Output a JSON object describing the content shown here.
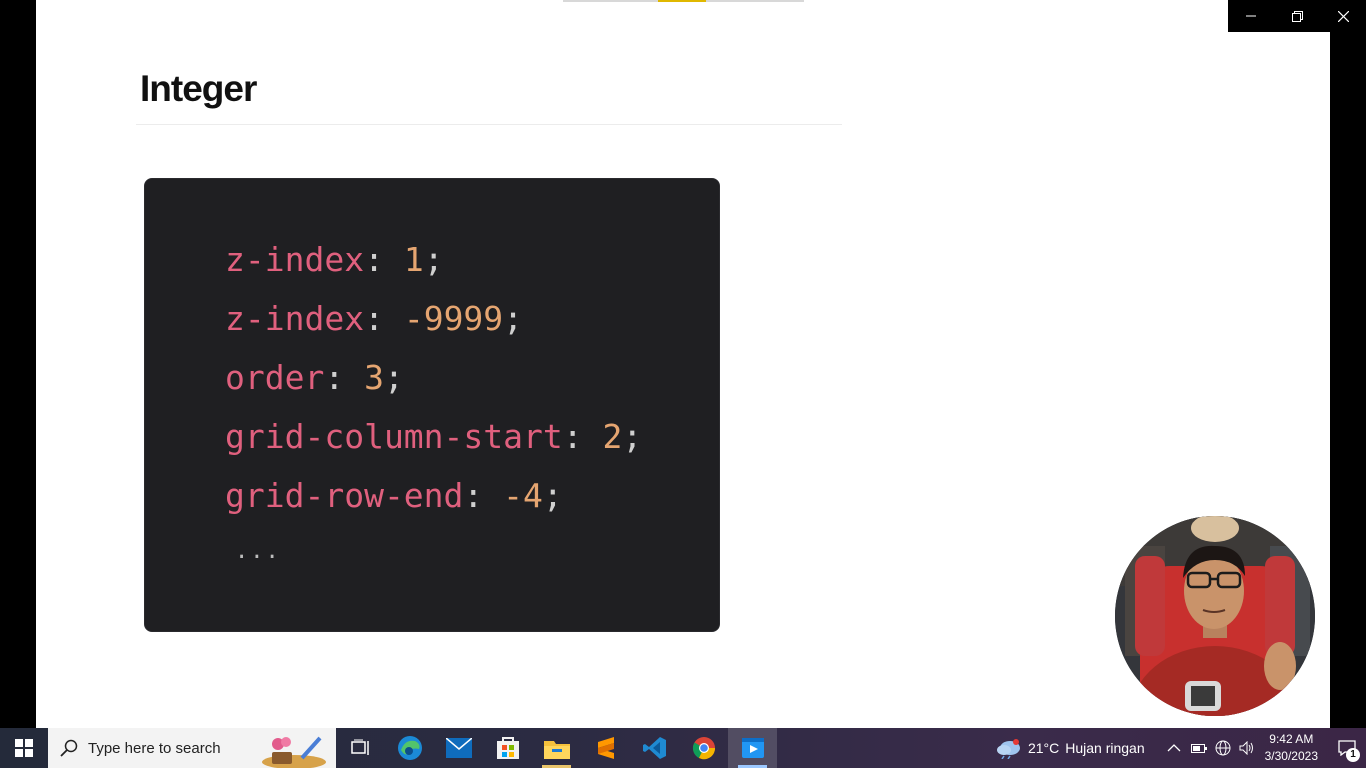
{
  "slide": {
    "title": "Integer",
    "code_lines": [
      {
        "prop": "z-index",
        "value": "1"
      },
      {
        "prop": "z-index",
        "value": "-9999"
      },
      {
        "prop": "order",
        "value": "3"
      },
      {
        "prop": "grid-column-start",
        "value": "2"
      },
      {
        "prop": "grid-row-end",
        "value": "-4"
      }
    ],
    "ellipsis": "...",
    "colon": ":",
    "semicolon": ";"
  },
  "window_controls": {
    "minimize_icon": "minimize-icon",
    "restore_icon": "restore-icon",
    "close_icon": "close-icon"
  },
  "taskbar": {
    "search_placeholder": "Type here to search",
    "apps": [
      "task-view-icon",
      "edge-icon",
      "mail-icon",
      "store-icon",
      "file-explorer-icon",
      "sublime-text-icon",
      "vscode-icon",
      "chrome-icon",
      "video-player-icon"
    ],
    "weather": {
      "temp": "21°C",
      "desc": "Hujan ringan"
    },
    "time": "9:42 AM",
    "date": "3/30/2023",
    "notification_count": "1"
  },
  "colors": {
    "code_bg": "#1f1f22",
    "prop": "#e0607e",
    "value": "#e5a571",
    "progress_fill": "#e0b800"
  }
}
